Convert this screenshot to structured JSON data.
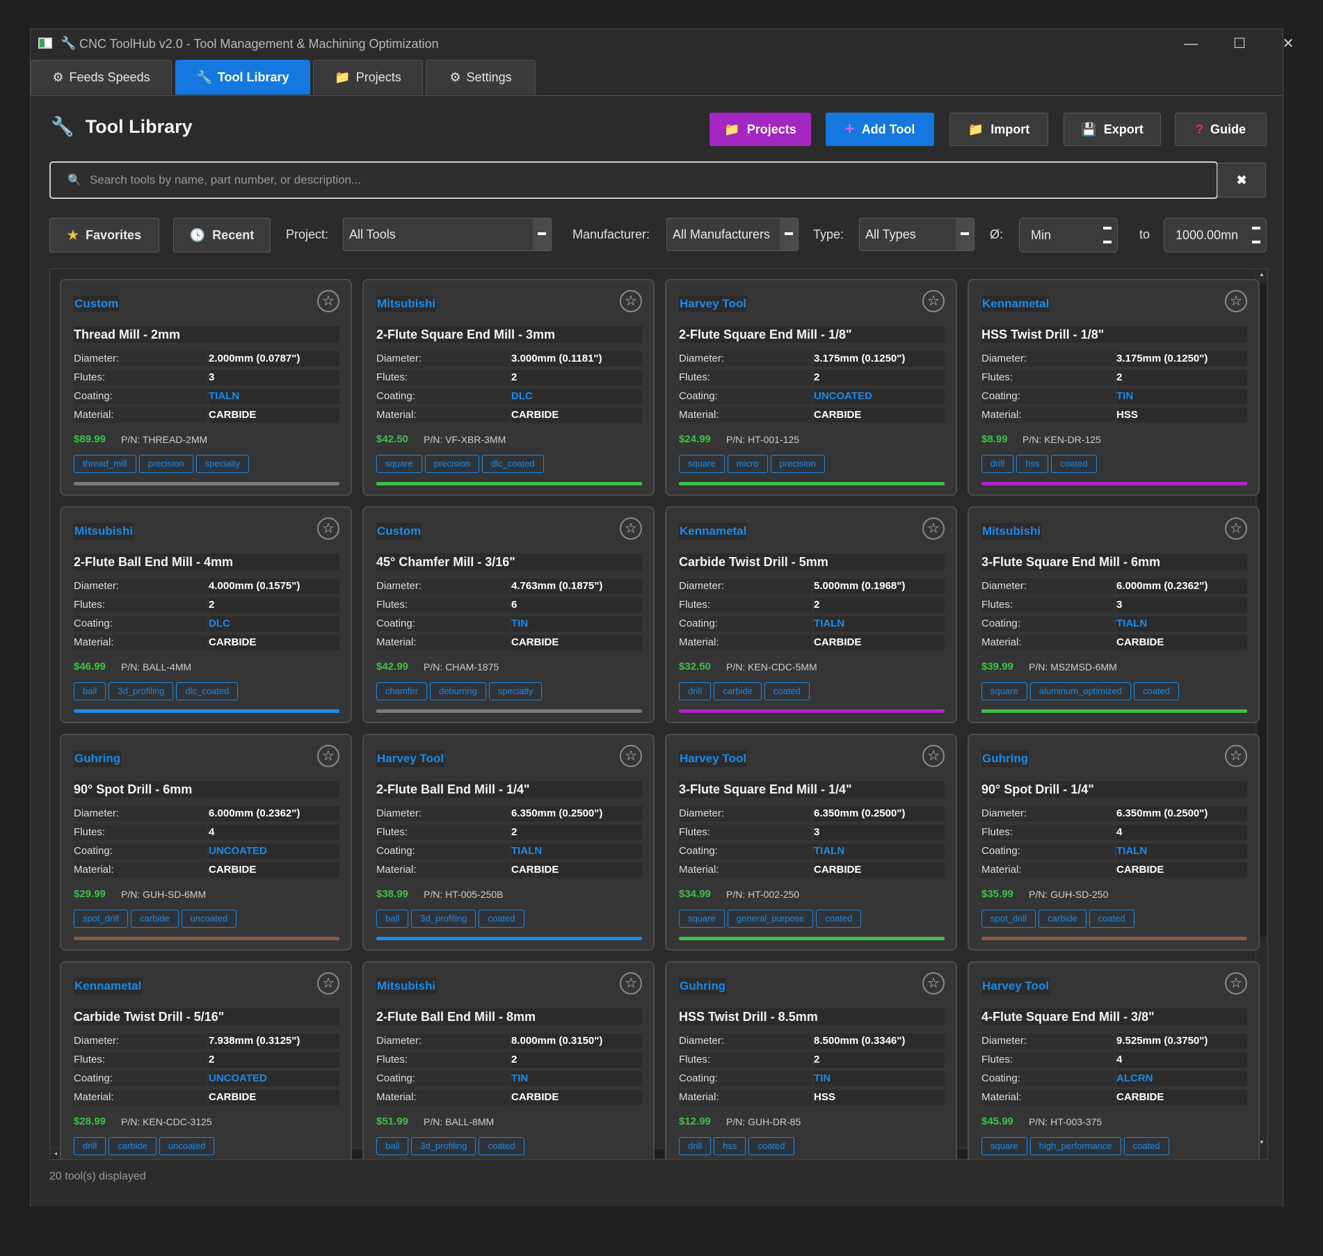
{
  "window": {
    "title": "CNC ToolHub v2.0 - Tool Management & Machining Optimization",
    "minimize": "—",
    "maximize": "☐",
    "close": "✕"
  },
  "tabs": [
    {
      "label": "Feeds  Speeds",
      "icon": "⚙"
    },
    {
      "label": "Tool Library",
      "icon": "🔧"
    },
    {
      "label": "Projects",
      "icon": "📁"
    },
    {
      "label": "Settings",
      "icon": "⚙"
    }
  ],
  "header": {
    "title": "Tool Library",
    "title_icon": "🔧",
    "buttons": {
      "projects": "Projects",
      "add_tool": "Add Tool",
      "import": "Import",
      "export": "Export",
      "guide": "Guide"
    },
    "icons": {
      "projects": "📁",
      "add_tool": "+",
      "import": "📁",
      "export": "💾",
      "guide": "?"
    }
  },
  "search": {
    "placeholder": "Search tools by name, part number, or description...",
    "value": "",
    "clear": "✖"
  },
  "filters": {
    "favorites": "Favorites",
    "recent": "Recent",
    "project_label": "Project:",
    "project_value": "All Tools",
    "manufacturer_label": "Manufacturer:",
    "manufacturer_value": "All Manufacturers",
    "type_label": "Type:",
    "type_value": "All Types",
    "diameter_label": "Ø:",
    "diameter_min": "Min",
    "to_label": "to",
    "diameter_max": "1000.00mn"
  },
  "labels": {
    "diameter": "Diameter:",
    "flutes": "Flutes:",
    "coating": "Coating:",
    "material": "Material:"
  },
  "colors": {
    "accent": "#1478e0",
    "projects": "#a327c0",
    "price": "#3ec04a",
    "bar_green": "#3ec04a",
    "bar_gray": "#7a7a7a",
    "bar_purple": "#b025c8",
    "bar_blue": "#1e8ae8",
    "bar_brown": "#8a5a48"
  },
  "tools": [
    {
      "mfg": "Custom",
      "name": "Thread Mill - 2mm",
      "diameter": "2.000mm (0.0787\")",
      "flutes": "3",
      "coating": "TIALN",
      "material": "CARBIDE",
      "price": "$89.99",
      "pn": "P/N: THREAD-2MM",
      "tags": [
        "thread_mill",
        "precision",
        "specialty"
      ],
      "bar": "#7a7a7a"
    },
    {
      "mfg": "Mitsubishi",
      "name": "2-Flute Square End Mill - 3mm",
      "diameter": "3.000mm (0.1181\")",
      "flutes": "2",
      "coating": "DLC",
      "material": "CARBIDE",
      "price": "$42.50",
      "pn": "P/N: VF-XBR-3MM",
      "tags": [
        "square",
        "precision",
        "dlc_coated"
      ],
      "bar": "#3ec04a"
    },
    {
      "mfg": "Harvey Tool",
      "name": "2-Flute Square End Mill - 1/8\"",
      "diameter": "3.175mm (0.1250\")",
      "flutes": "2",
      "coating": "UNCOATED",
      "material": "CARBIDE",
      "price": "$24.99",
      "pn": "P/N: HT-001-125",
      "tags": [
        "square",
        "micro",
        "precision"
      ],
      "bar": "#3ec04a"
    },
    {
      "mfg": "Kennametal",
      "name": "HSS Twist Drill - 1/8\"",
      "diameter": "3.175mm (0.1250\")",
      "flutes": "2",
      "coating": "TIN",
      "material": "HSS",
      "price": "$8.99",
      "pn": "P/N: KEN-DR-125",
      "tags": [
        "drill",
        "hss",
        "coated"
      ],
      "bar": "#b025c8"
    },
    {
      "mfg": "Mitsubishi",
      "name": "2-Flute Ball End Mill - 4mm",
      "diameter": "4.000mm (0.1575\")",
      "flutes": "2",
      "coating": "DLC",
      "material": "CARBIDE",
      "price": "$46.99",
      "pn": "P/N: BALL-4MM",
      "tags": [
        "ball",
        "3d_profiling",
        "dlc_coated"
      ],
      "bar": "#1e8ae8"
    },
    {
      "mfg": "Custom",
      "name": "45° Chamfer Mill - 3/16\"",
      "diameter": "4.763mm (0.1875\")",
      "flutes": "6",
      "coating": "TIN",
      "material": "CARBIDE",
      "price": "$42.99",
      "pn": "P/N: CHAM-1875",
      "tags": [
        "chamfer",
        "deburring",
        "specialty"
      ],
      "bar": "#7a7a7a"
    },
    {
      "mfg": "Kennametal",
      "name": "Carbide Twist Drill - 5mm",
      "diameter": "5.000mm (0.1968\")",
      "flutes": "2",
      "coating": "TIALN",
      "material": "CARBIDE",
      "price": "$32.50",
      "pn": "P/N: KEN-CDC-5MM",
      "tags": [
        "drill",
        "carbide",
        "coated"
      ],
      "bar": "#b025c8"
    },
    {
      "mfg": "Mitsubishi",
      "name": "3-Flute Square End Mill - 6mm",
      "diameter": "6.000mm (0.2362\")",
      "flutes": "3",
      "coating": "TIALN",
      "material": "CARBIDE",
      "price": "$39.99",
      "pn": "P/N: MS2MSD-6MM",
      "tags": [
        "square",
        "aluminum_optimized",
        "coated"
      ],
      "bar": "#3ec04a"
    },
    {
      "mfg": "Guhring",
      "name": "90° Spot Drill - 6mm",
      "diameter": "6.000mm (0.2362\")",
      "flutes": "4",
      "coating": "UNCOATED",
      "material": "CARBIDE",
      "price": "$29.99",
      "pn": "P/N: GUH-SD-6MM",
      "tags": [
        "spot_drill",
        "carbide",
        "uncoated"
      ],
      "bar": "#8a5a48"
    },
    {
      "mfg": "Harvey Tool",
      "name": "2-Flute Ball End Mill - 1/4\"",
      "diameter": "6.350mm (0.2500\")",
      "flutes": "2",
      "coating": "TIALN",
      "material": "CARBIDE",
      "price": "$38.99",
      "pn": "P/N: HT-005-250B",
      "tags": [
        "ball",
        "3d_profiling",
        "coated"
      ],
      "bar": "#1e8ae8"
    },
    {
      "mfg": "Harvey Tool",
      "name": "3-Flute Square End Mill - 1/4\"",
      "diameter": "6.350mm (0.2500\")",
      "flutes": "3",
      "coating": "TIALN",
      "material": "CARBIDE",
      "price": "$34.99",
      "pn": "P/N: HT-002-250",
      "tags": [
        "square",
        "general_purpose",
        "coated"
      ],
      "bar": "#3ec04a"
    },
    {
      "mfg": "Guhring",
      "name": "90° Spot Drill - 1/4\"",
      "diameter": "6.350mm (0.2500\")",
      "flutes": "4",
      "coating": "TIALN",
      "material": "CARBIDE",
      "price": "$35.99",
      "pn": "P/N: GUH-SD-250",
      "tags": [
        "spot_drill",
        "carbide",
        "coated"
      ],
      "bar": "#8a5a48"
    },
    {
      "mfg": "Kennametal",
      "name": "Carbide Twist Drill - 5/16\"",
      "diameter": "7.938mm (0.3125\")",
      "flutes": "2",
      "coating": "UNCOATED",
      "material": "CARBIDE",
      "price": "$28.99",
      "pn": "P/N: KEN-CDC-3125",
      "tags": [
        "drill",
        "carbide",
        "uncoated"
      ],
      "bar": "#b025c8"
    },
    {
      "mfg": "Mitsubishi",
      "name": "2-Flute Ball End Mill - 8mm",
      "diameter": "8.000mm (0.3150\")",
      "flutes": "2",
      "coating": "TIN",
      "material": "CARBIDE",
      "price": "$51.99",
      "pn": "P/N: BALL-8MM",
      "tags": [
        "ball",
        "3d_profiling",
        "coated"
      ],
      "bar": "#1e8ae8"
    },
    {
      "mfg": "Guhring",
      "name": "HSS Twist Drill - 8.5mm",
      "diameter": "8.500mm (0.3346\")",
      "flutes": "2",
      "coating": "TIN",
      "material": "HSS",
      "price": "$12.99",
      "pn": "P/N: GUH-DR-85",
      "tags": [
        "drill",
        "hss",
        "coated"
      ],
      "bar": "#b025c8"
    },
    {
      "mfg": "Harvey Tool",
      "name": "4-Flute Square End Mill - 3/8\"",
      "diameter": "9.525mm (0.3750\")",
      "flutes": "4",
      "coating": "ALCRN",
      "material": "CARBIDE",
      "price": "$45.99",
      "pn": "P/N: HT-003-375",
      "tags": [
        "square",
        "high_performance",
        "coated"
      ],
      "bar": "#3ec04a"
    }
  ],
  "status": "20 tool(s) displayed"
}
